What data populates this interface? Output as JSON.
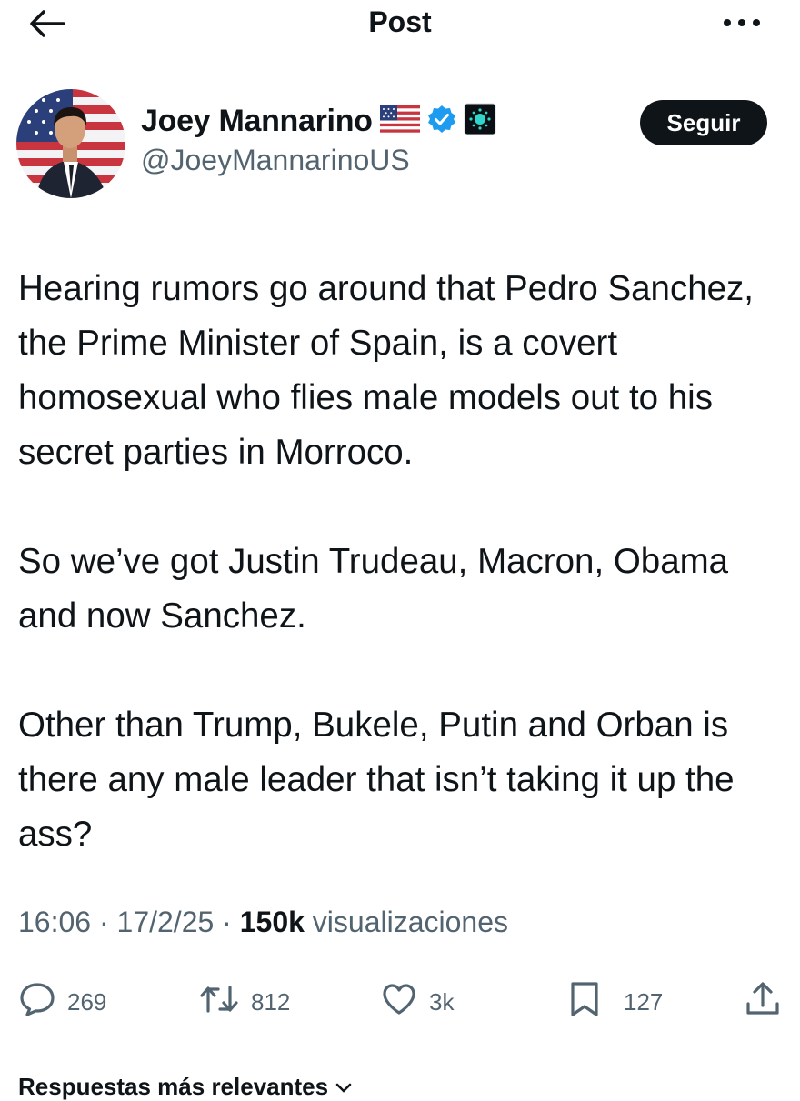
{
  "header": {
    "title": "Post",
    "back_icon": "arrow-left-icon",
    "more_icon": "more-horizontal-icon"
  },
  "author": {
    "name": "Joey Mannarino",
    "handle": "@JoeyMannarinoUS",
    "badges": [
      "us-flag-icon",
      "verified-badge-icon",
      "affiliate-badge-icon"
    ],
    "follow_label": "Seguir"
  },
  "tweet": {
    "paragraphs": [
      "Hearing rumors go around that Pedro Sanchez, the Prime Minister of Spain, is a covert homosexual who flies male models out to his secret parties in Morroco.",
      "So we’ve got Justin Trudeau, Macron, Obama and now Sanchez.",
      "Other than Trump, Bukele, Putin and Orban is there any male leader that isn’t taking it up the ass?"
    ],
    "time": "16:06",
    "date": "17/2/25",
    "views_count": "150k",
    "views_label": "visualizaciones",
    "separator": "·"
  },
  "actions": {
    "replies": "269",
    "reposts": "812",
    "likes": "3k",
    "bookmarks": "127"
  },
  "replies_sort": {
    "label": "Respuestas más relevantes"
  },
  "colors": {
    "text": "#0f1419",
    "secondary": "#536471",
    "verified": "#1d9bf0",
    "follow_bg": "#0f1419"
  }
}
